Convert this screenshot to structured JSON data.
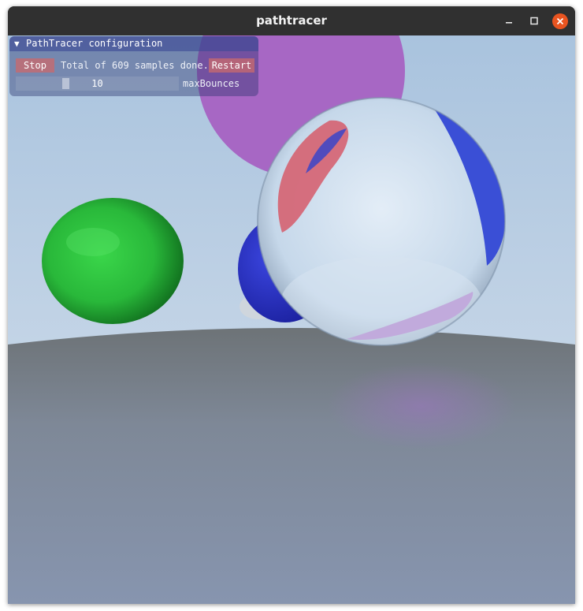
{
  "window": {
    "title": "pathtracer",
    "controls": [
      "minimize-icon",
      "maximize-icon",
      "close-icon"
    ],
    "accent_close": "#e95420"
  },
  "panel": {
    "title": "PathTracer configuration",
    "collapse_glyph": "▼",
    "stop_label": "Stop",
    "status_text": "Total of 609 samples done.",
    "restart_label": "Restart",
    "slider": {
      "label": "maxBounces",
      "value": "10",
      "level": 0.3
    }
  },
  "colors": {
    "button": "#c8696e",
    "panel_header": "#3c4896",
    "sky": "#b2c9e1",
    "ground": "#8796ac"
  }
}
